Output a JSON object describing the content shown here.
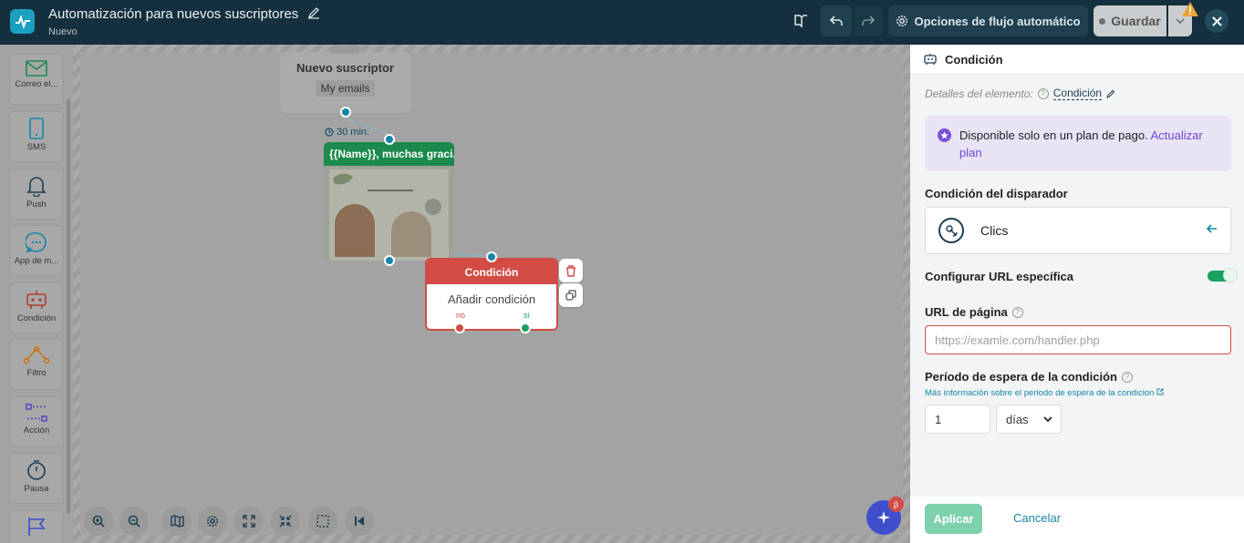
{
  "topbar": {
    "title": "Automatización para nuevos suscriptores",
    "subtitle": "Nuevo",
    "flow_options_label": "Opciones de flujo automático",
    "save_label": "Guardar"
  },
  "sidebar": {
    "items": [
      {
        "label": "Correo el...",
        "icon": "mail-icon"
      },
      {
        "label": "SMS",
        "icon": "phone-icon"
      },
      {
        "label": "Push",
        "icon": "bell-icon"
      },
      {
        "label": "App de m...",
        "icon": "chat-icon"
      },
      {
        "label": "Condición",
        "icon": "robot-icon"
      },
      {
        "label": "Filtro",
        "icon": "filter-icon"
      },
      {
        "label": "Acción",
        "icon": "action-icon"
      },
      {
        "label": "Pausa",
        "icon": "timer-icon"
      }
    ]
  },
  "flow": {
    "start_node": {
      "title": "Nuevo suscriptor",
      "list": "My emails"
    },
    "delay_label": "30 min.",
    "email_node": {
      "title": "{{Name}}, muchas graci..."
    },
    "condition_node": {
      "title": "Condición",
      "body": "Añadir condición",
      "no_label": "no",
      "yes_label": "sí"
    }
  },
  "ai": {
    "beta": "β"
  },
  "panel": {
    "header": "Condición",
    "details_label": "Detalles del elemento:",
    "details_value": "Condición",
    "paid_text": "Disponible solo en un plan de pago.",
    "paid_link": "Actualizar plan",
    "trigger_label": "Condición del disparador",
    "trigger_value": "Clics",
    "specific_url_label": "Configurar URL específica",
    "specific_url_enabled": true,
    "page_url_label": "URL de página",
    "page_url_placeholder": "https://examle.com/handler.php",
    "wait_label": "Período de espera de la condición",
    "wait_more": "Más información sobre el periodo de espera de la condicion",
    "wait_value": "1",
    "wait_unit": "días",
    "apply_label": "Aplicar",
    "cancel_label": "Cancelar"
  },
  "colors": {
    "brand_dark": "#142f3d",
    "accent": "#1586a8",
    "condition_red": "#d24c45",
    "email_green": "#1b8a4c",
    "apply_green": "#7fd1ad"
  }
}
